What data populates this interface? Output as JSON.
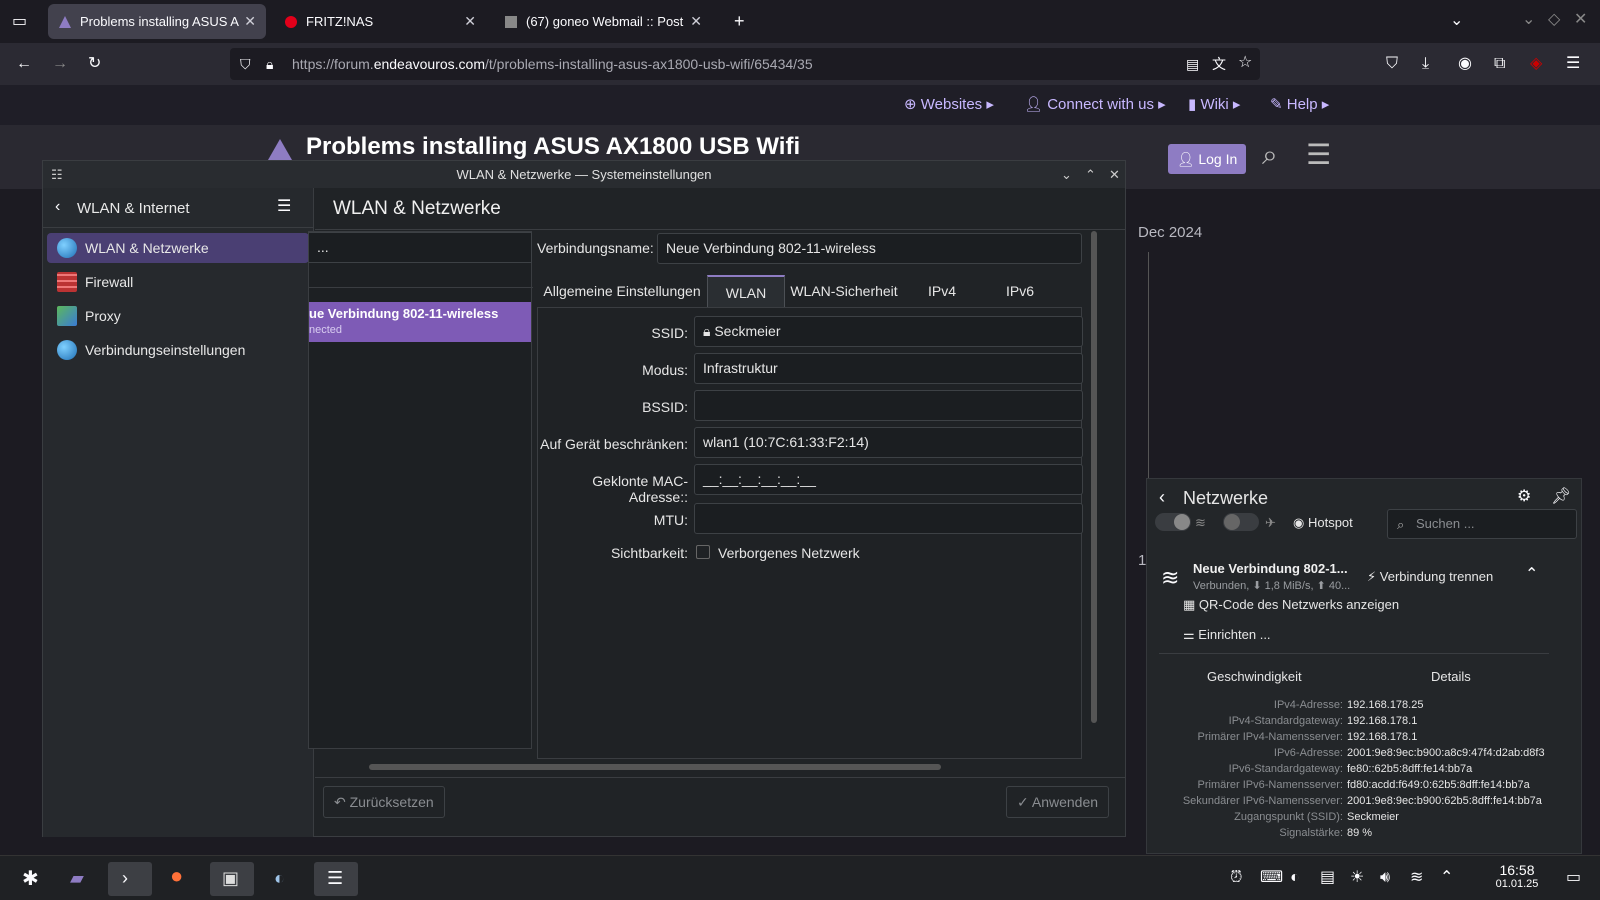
{
  "browser": {
    "tabs": [
      {
        "label": "Problems installing ASUS A",
        "active": true
      },
      {
        "label": "FRITZ!NAS",
        "active": false
      },
      {
        "label": "(67) goneo Webmail :: Post",
        "active": false
      }
    ],
    "url_prefix": "https://forum.",
    "url_domain": "endeavouros.com",
    "url_path": "/t/problems-installing-asus-ax1800-usb-wifi/65434/35"
  },
  "forum": {
    "nav": [
      "Websites",
      "Connect with us",
      "Wiki",
      "Help"
    ],
    "title": "Problems installing ASUS AX1800 USB Wifi",
    "login_label": "Log In",
    "timeline_label": "Dec 2024",
    "timeline_num": "1"
  },
  "settings": {
    "window_title": "WLAN & Netzwerke — Systemeinstellungen",
    "sidebar_title": "WLAN & Internet",
    "sidebar_items": [
      "WLAN & Netzwerke",
      "Firewall",
      "Proxy",
      "Verbindungseinstellungen"
    ],
    "page_title": "WLAN & Netzwerke",
    "list_search": "...",
    "list_item_name": "ue Verbindung 802-11-wireless",
    "list_item_status": "nected",
    "conn_name_label": "Verbindungsname:",
    "conn_name_value": "Neue Verbindung 802-11-wireless",
    "tabs": [
      "Allgemeine Einstellungen",
      "WLAN",
      "WLAN-Sicherheit",
      "IPv4",
      "IPv6"
    ],
    "fields": {
      "ssid_label": "SSID:",
      "ssid_value": "Seckmeier",
      "mode_label": "Modus:",
      "mode_value": "Infrastruktur",
      "bssid_label": "BSSID:",
      "bssid_value": "",
      "device_label": "Auf Gerät beschränken:",
      "device_value": "wlan1 (10:7C:61:33:F2:14)",
      "mac_label": "Geklonte MAC-Adresse::",
      "mac_value": "__:__:__:__:__:__",
      "mtu_label": "MTU:",
      "mtu_value": "",
      "visibility_label": "Sichtbarkeit:",
      "hidden_label": "Verborgenes Netzwerk"
    },
    "reset_label": "Zurücksetzen",
    "apply_label": "Anwenden"
  },
  "applet": {
    "title": "Netzwerke",
    "hotspot_label": "Hotspot",
    "search_placeholder": "Suchen ...",
    "conn_name": "Neue Verbindung 802-1...",
    "conn_status": "Verbunden, ⬇ 1,8 MiB/s, ⬆ 40...",
    "disconnect_label": "Verbindung trennen",
    "qr_label": "QR-Code des Netzwerks anzeigen",
    "setup_label": "Einrichten ...",
    "tab_speed": "Geschwindigkeit",
    "tab_details": "Details",
    "details": [
      {
        "k": "IPv4-Adresse:",
        "v": "192.168.178.25"
      },
      {
        "k": "IPv4-Standardgateway:",
        "v": "192.168.178.1"
      },
      {
        "k": "Primärer IPv4-Namensserver:",
        "v": "192.168.178.1"
      },
      {
        "k": "IPv6-Adresse:",
        "v": "2001:9e8:9ec:b900:a8c9:47f4:d2ab:d8f3"
      },
      {
        "k": "IPv6-Standardgateway:",
        "v": "fe80::62b5:8dff:fe14:bb7a"
      },
      {
        "k": "Primärer IPv6-Namensserver:",
        "v": "fd80:acdd:f649:0:62b5:8dff:fe14:bb7a"
      },
      {
        "k": "Sekundärer IPv6-Namensserver:",
        "v": "2001:9e8:9ec:b900:62b5:8dff:fe14:bb7a"
      },
      {
        "k": "Zugangspunkt (SSID):",
        "v": "Seckmeier"
      },
      {
        "k": "Signalstärke:",
        "v": "89 %"
      }
    ]
  },
  "taskbar": {
    "time": "16:58",
    "date": "01.01.25"
  },
  "colors": {
    "accent": "#8e7cc3",
    "selection": "#7e5bb6"
  }
}
